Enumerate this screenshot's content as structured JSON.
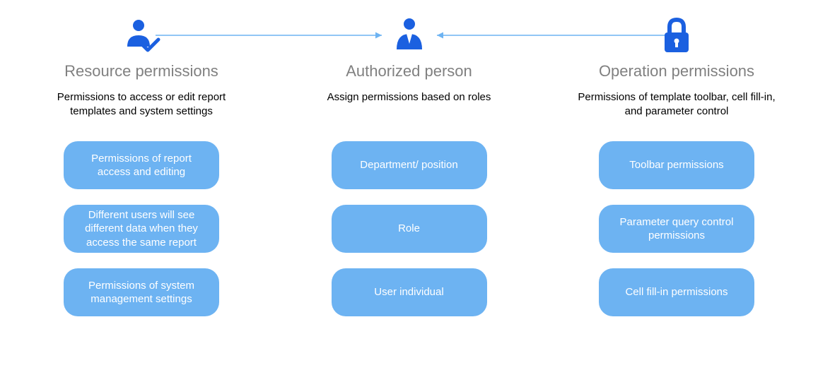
{
  "colors": {
    "icon_blue": "#1b60e0",
    "pill_blue": "#6db3f2",
    "title_gray": "#808080",
    "arrow_blue": "#6db3f2"
  },
  "arrows": [
    {
      "from": "resource",
      "to": "authorized",
      "direction": "right"
    },
    {
      "from": "operation",
      "to": "authorized",
      "direction": "left"
    }
  ],
  "columns": [
    {
      "key": "resource",
      "icon": "user-check",
      "title": "Resource permissions",
      "desc": "Permissions to access or edit report templates and system settings",
      "pills": [
        "Permissions of report access and editing",
        "Different users will see different data when they access the same report",
        "Permissions of system management settings"
      ]
    },
    {
      "key": "authorized",
      "icon": "business-person",
      "title": "Authorized person",
      "desc": "Assign permissions based on roles",
      "pills": [
        "Department/ position",
        "Role",
        "User individual"
      ]
    },
    {
      "key": "operation",
      "icon": "lock",
      "title": "Operation permissions",
      "desc": "Permissions of template toolbar, cell fill-in, and parameter control",
      "pills": [
        "Toolbar permissions",
        "Parameter query control permissions",
        "Cell fill-in permissions"
      ]
    }
  ]
}
